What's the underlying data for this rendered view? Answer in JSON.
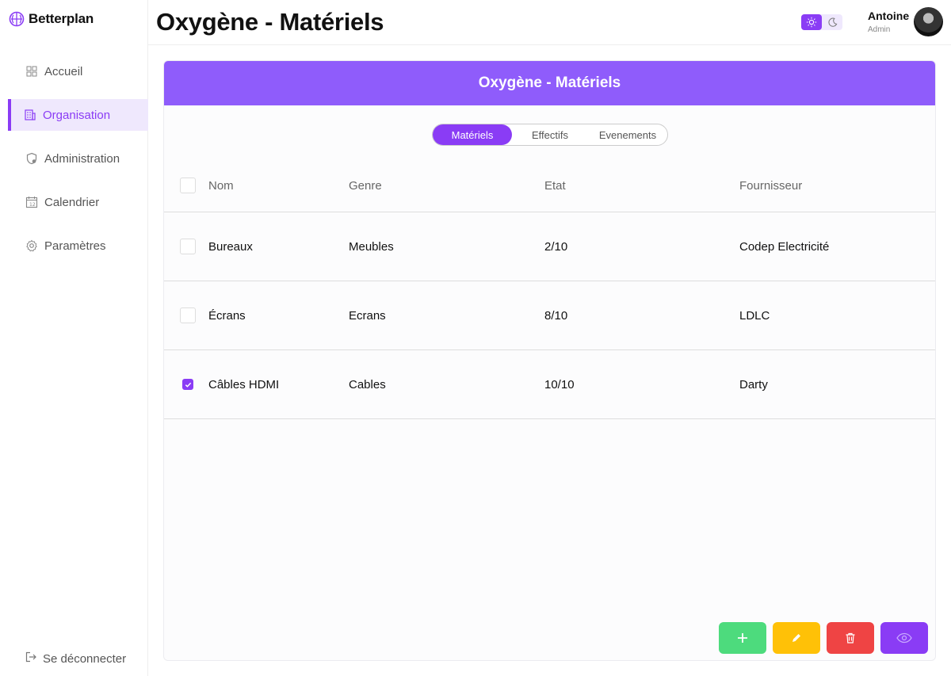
{
  "app": {
    "brand": "Betterplan"
  },
  "sidebar": {
    "items": [
      {
        "label": "Accueil",
        "icon": "grid-icon"
      },
      {
        "label": "Organisation",
        "icon": "building-icon"
      },
      {
        "label": "Administration",
        "icon": "shield-icon"
      },
      {
        "label": "Calendrier",
        "icon": "calendar-icon"
      },
      {
        "label": "Paramètres",
        "icon": "gear-icon"
      }
    ],
    "active_index": 1,
    "logout_label": "Se déconnecter"
  },
  "header": {
    "title": "Oxygène - Matériels",
    "theme_mode": "light",
    "user_name": "Antoine",
    "user_role": "Admin"
  },
  "card": {
    "title": "Oxygène - Matériels",
    "tabs": [
      {
        "label": "Matériels",
        "active": true
      },
      {
        "label": "Effectifs",
        "active": false
      },
      {
        "label": "Evenements",
        "active": false
      }
    ],
    "columns": [
      "Nom",
      "Genre",
      "Etat",
      "Fournisseur"
    ],
    "rows": [
      {
        "nom": "Bureaux",
        "genre": "Meubles",
        "etat": "2/10",
        "fournisseur": "Codep Electricité",
        "checked": false
      },
      {
        "nom": "Écrans",
        "genre": "Ecrans",
        "etat": "8/10",
        "fournisseur": "LDLC",
        "checked": false
      },
      {
        "nom": "Câbles HDMI",
        "genre": "Cables",
        "etat": "10/10",
        "fournisseur": "Darty",
        "checked": true
      }
    ]
  },
  "colors": {
    "accent": "#8a3cf5",
    "header_bg": "#8f5cfb",
    "add": "#4ddb7d",
    "edit": "#ffc107",
    "delete": "#ef4444"
  }
}
